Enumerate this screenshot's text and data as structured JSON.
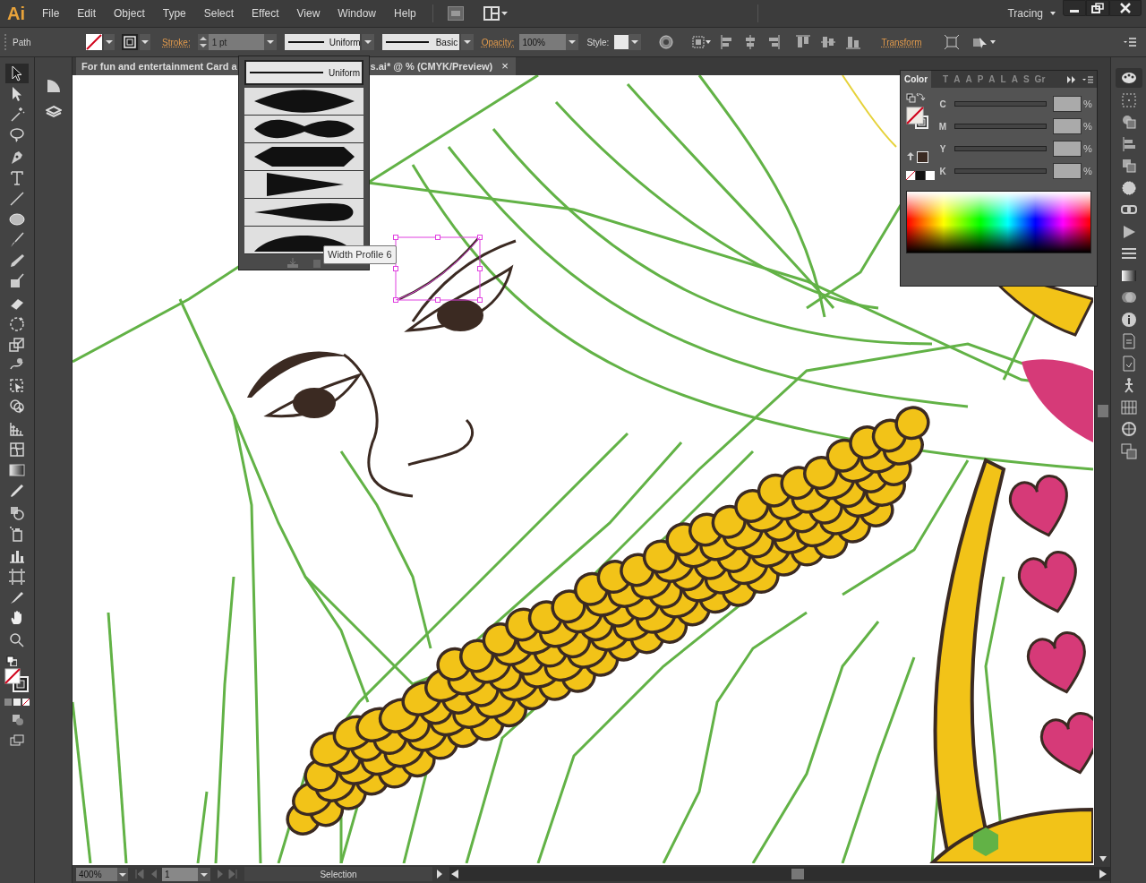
{
  "app": {
    "logo": "Ai",
    "menu": [
      "File",
      "Edit",
      "Object",
      "Type",
      "Select",
      "Effect",
      "View",
      "Window",
      "Help"
    ],
    "workspace": "Tracing"
  },
  "control_bar": {
    "selection_type": "Path",
    "stroke_label": "Stroke:",
    "stroke_weight": "1 pt",
    "profile": "Uniform",
    "brush": "Basic",
    "opacity_label": "Opacity:",
    "opacity": "100%",
    "style_label": "Style:",
    "transform": "Transform"
  },
  "document_tab": {
    "title_start": "For fun and entertainment Card a",
    "title_end": "s.ai* @ % (CMYK/Preview)",
    "close": "×"
  },
  "width_profile_menu": {
    "items": [
      {
        "kind": "uniform",
        "label": "Uniform",
        "selected": true
      },
      {
        "kind": "lens",
        "selected": false
      },
      {
        "kind": "pinch",
        "selected": false
      },
      {
        "kind": "hexagon",
        "selected": false
      },
      {
        "kind": "wedge",
        "selected": false
      },
      {
        "kind": "teardrop",
        "selected": false
      },
      {
        "kind": "dome",
        "selected": false
      }
    ],
    "tooltip": "Width Profile 6"
  },
  "color_panel": {
    "tabs": [
      {
        "label": "Color",
        "selected": true
      },
      {
        "label": "T",
        "selected": false
      },
      {
        "label": "A",
        "selected": false
      },
      {
        "label": "A",
        "selected": false
      },
      {
        "label": "P",
        "selected": false
      },
      {
        "label": "A",
        "selected": false
      },
      {
        "label": "L",
        "selected": false
      },
      {
        "label": "A",
        "selected": false
      },
      {
        "label": "S",
        "selected": false
      },
      {
        "label": "Gr",
        "selected": false
      }
    ],
    "channels": [
      {
        "name": "C",
        "unit": "%",
        "level": 0
      },
      {
        "name": "M",
        "unit": "%",
        "level": 0
      },
      {
        "name": "Y",
        "unit": "%",
        "level": 0
      },
      {
        "name": "K",
        "unit": "%",
        "level": 0
      }
    ]
  },
  "status_bar": {
    "zoom": "400%",
    "artboard": "1",
    "status": "Selection"
  }
}
